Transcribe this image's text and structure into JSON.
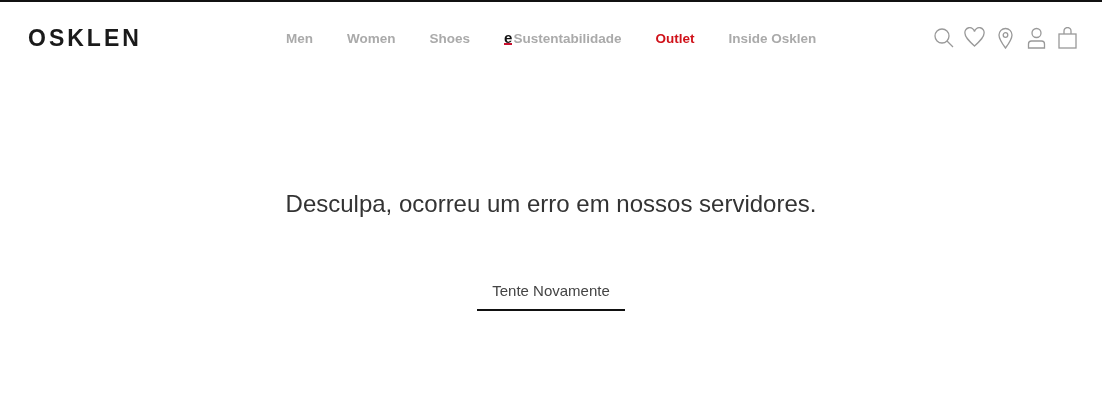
{
  "header": {
    "logo": "OSKLEN",
    "nav": [
      {
        "label": "Men",
        "kind": "plain"
      },
      {
        "label": "Women",
        "kind": "plain"
      },
      {
        "label": "Shoes",
        "kind": "plain"
      },
      {
        "label": "Sustentabilidade",
        "kind": "eco",
        "mark": "e"
      },
      {
        "label": "Outlet",
        "kind": "sale"
      },
      {
        "label": "Inside Osklen",
        "kind": "plain"
      }
    ]
  },
  "error": {
    "message": "Desculpa, ocorreu um erro em nossos servidores.",
    "button": "Tente Novamente"
  }
}
